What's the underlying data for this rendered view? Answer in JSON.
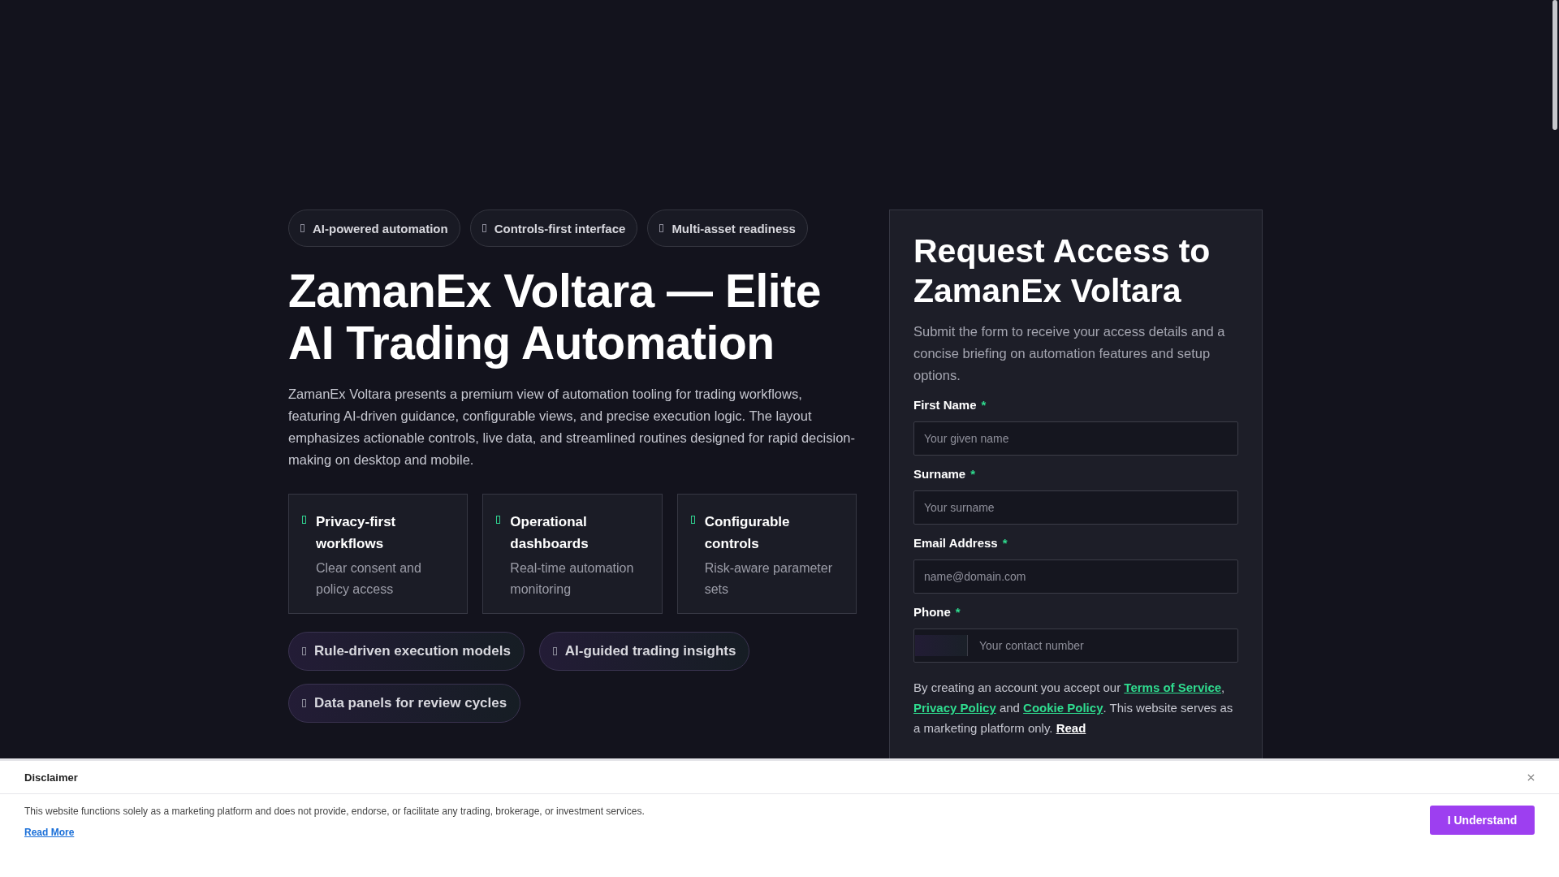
{
  "top_badges": [
    "AI-powered automation",
    "Controls-first interface",
    "Multi-asset readiness"
  ],
  "title": "ZamanEx Voltara — Elite AI Trading Automation",
  "description": "ZamanEx Voltara presents a premium view of automation tooling for trading workflows, featuring AI-driven guidance, configurable views, and precise execution logic. The layout emphasizes actionable controls, live data, and streamlined routines designed for rapid decision-making on desktop and mobile.",
  "feature_cards": [
    {
      "title": "Privacy-first workflows",
      "subtitle": "Clear consent and policy access"
    },
    {
      "title": "Operational dashboards",
      "subtitle": "Real-time automation monitoring"
    },
    {
      "title": "Configurable controls",
      "subtitle": "Risk-aware parameter sets"
    }
  ],
  "highlight_pills": [
    "Rule-driven execution models",
    "AI-guided trading insights",
    "Data panels for review cycles"
  ],
  "form": {
    "title": "Request Access to ZamanEx Voltara",
    "subtitle": "Submit the form to receive your access details and a concise briefing on automation features and setup options.",
    "fields": [
      {
        "kind": "text",
        "label": "First Name",
        "required_mark": "*",
        "placeholder": "Your given name"
      },
      {
        "kind": "text",
        "label": "Surname",
        "required_mark": "*",
        "placeholder": "Your surname"
      },
      {
        "kind": "text",
        "label": "Email Address",
        "required_mark": "*",
        "placeholder": "name@domain.com"
      },
      {
        "kind": "phone",
        "label": "Phone",
        "required_mark": "*",
        "placeholder": "Your contact number"
      }
    ],
    "legal": [
      {
        "kind": "text",
        "text": "By creating an account you accept our "
      },
      {
        "kind": "link",
        "text": "Terms of Service"
      },
      {
        "kind": "text",
        "text": ", "
      },
      {
        "kind": "link",
        "text": "Privacy Policy"
      },
      {
        "kind": "text",
        "text": " and "
      },
      {
        "kind": "link",
        "text": "Cookie Policy"
      },
      {
        "kind": "text",
        "text": ". This website serves as a marketing platform only. "
      },
      {
        "kind": "plain_link",
        "text": "Read"
      }
    ]
  },
  "disclaimer": {
    "title": "Disclaimer",
    "text": "This website functions solely as a marketing platform and does not provide, endorse, or facilitate any trading, brokerage, or investment services.",
    "link": "Read More",
    "button": "I Understand"
  }
}
